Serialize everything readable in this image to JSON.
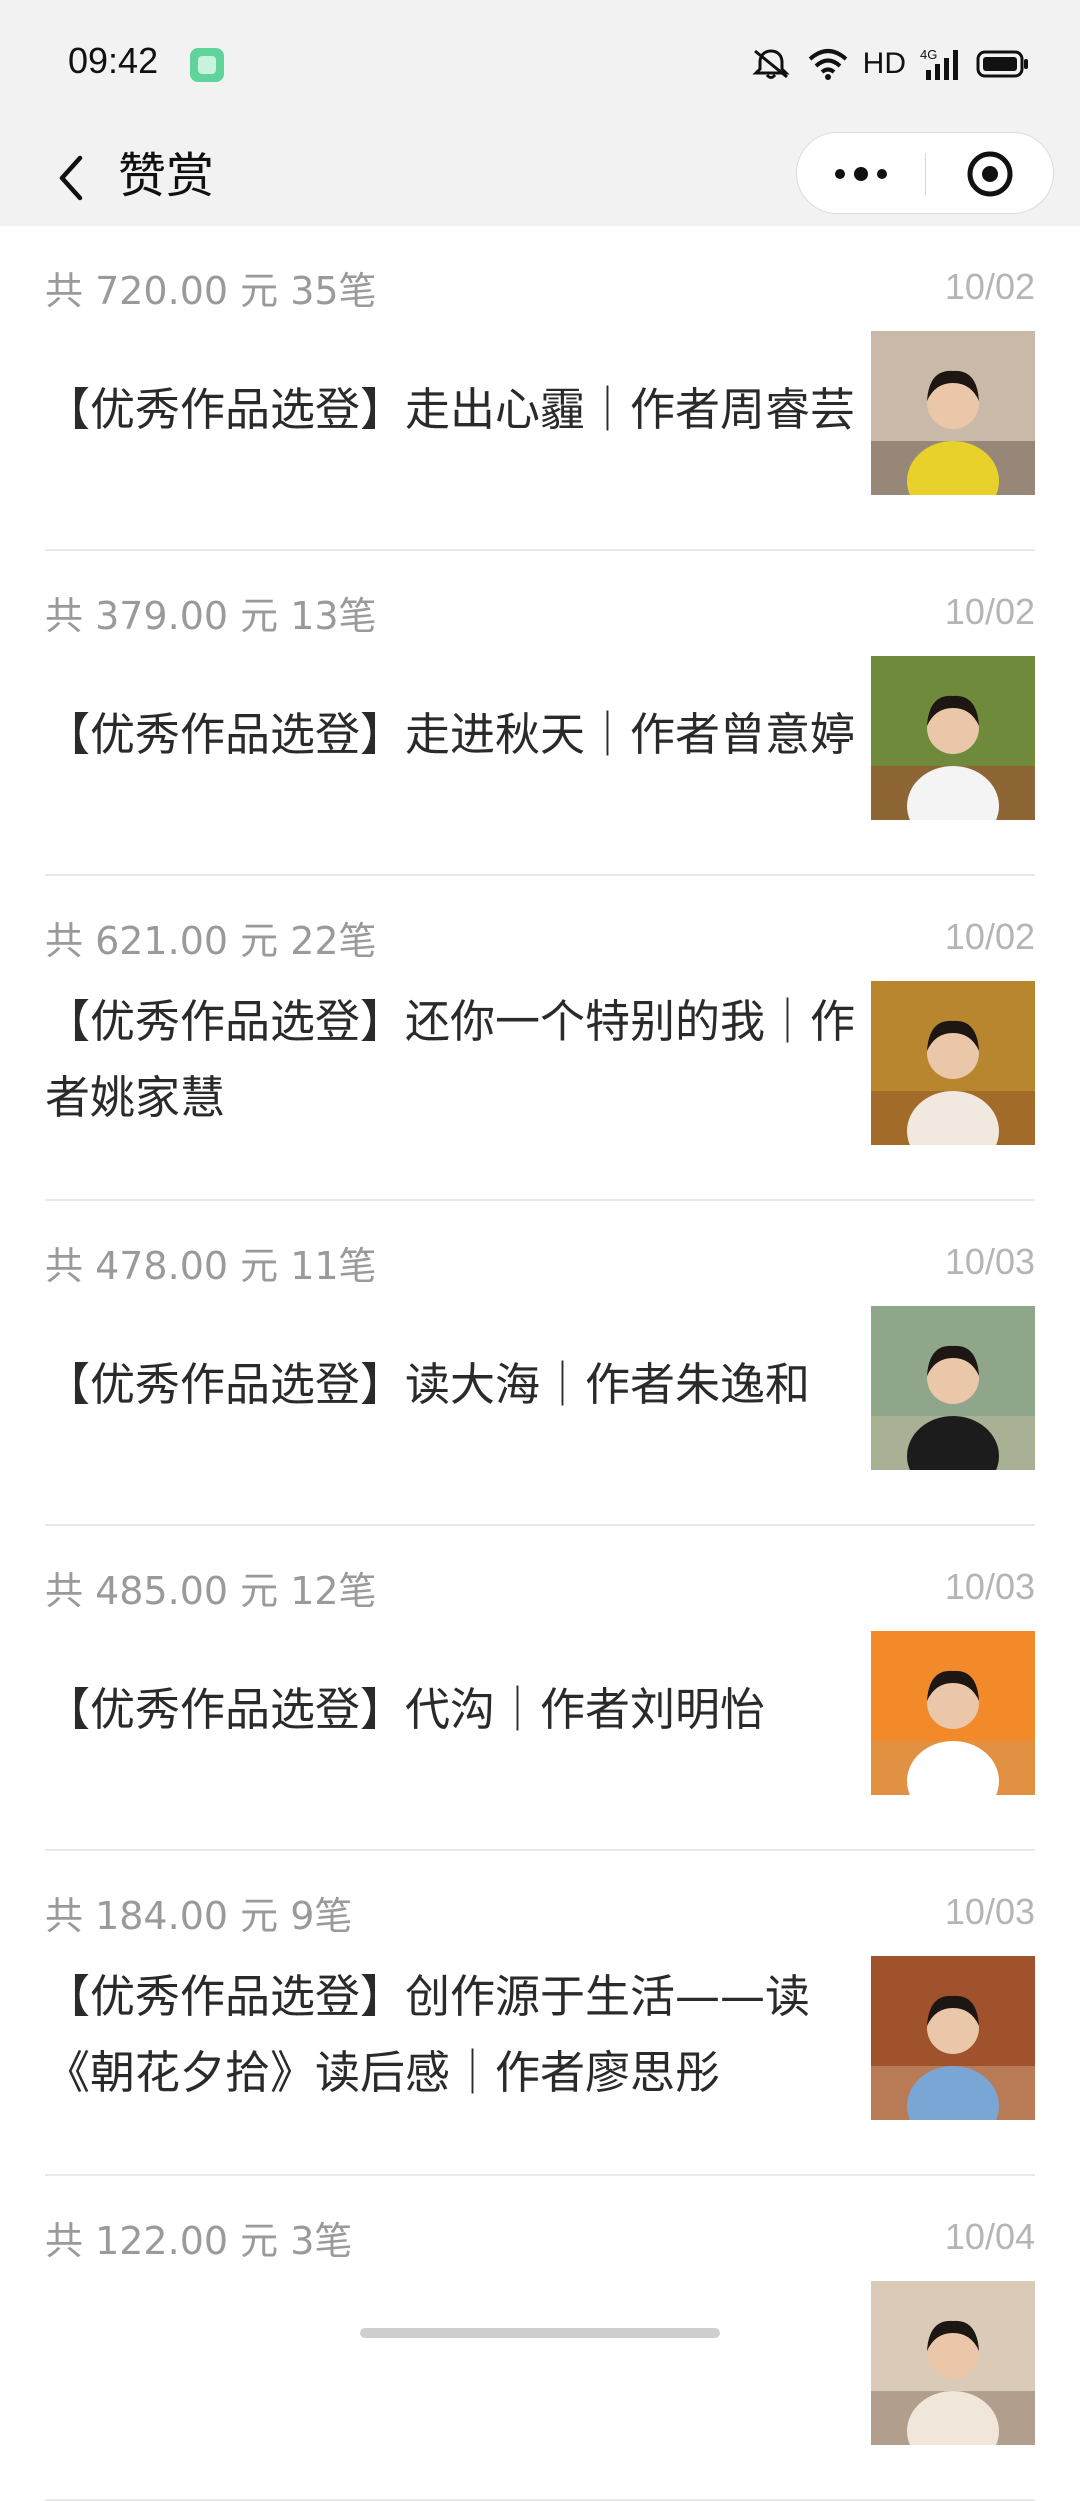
{
  "status": {
    "time": "09:42",
    "hd": "HD",
    "network": "4G"
  },
  "nav": {
    "title": "赞赏"
  },
  "icons": {
    "back": "chevron-left-icon",
    "more": "more-dots-icon",
    "close": "target-close-icon",
    "mute": "mute-icon",
    "wifi": "wifi-icon",
    "signal": "signal-icon",
    "battery": "battery-icon"
  },
  "items": [
    {
      "meta": "共 720.00 元  35笔",
      "date": "10/02",
      "title": "【优秀作品选登】走出心霾｜作者周睿芸",
      "thumb_colors": [
        "#c9b9a8",
        "#e8d12a",
        "#3a2a20"
      ]
    },
    {
      "meta": "共 379.00 元  13笔",
      "date": "10/02",
      "title": "【优秀作品选登】走进秋天｜作者曾意婷",
      "thumb_colors": [
        "#6f8a3a",
        "#f4f4f4",
        "#c8202a"
      ]
    },
    {
      "meta": "共 621.00 元  22笔",
      "date": "10/02",
      "title": "【优秀作品选登】还你一个特别的我｜作者姚家慧",
      "thumb_colors": [
        "#b8862e",
        "#f1e9df",
        "#7a3a20"
      ]
    },
    {
      "meta": "共 478.00 元  11笔",
      "date": "10/03",
      "title": "【优秀作品选登】读大海｜作者朱逸和",
      "thumb_colors": [
        "#8fa68a",
        "#1c1c1c",
        "#d9c7a6"
      ]
    },
    {
      "meta": "共 485.00 元  12笔",
      "date": "10/03",
      "title": "【优秀作品选登】代沟｜作者刘明怡",
      "thumb_colors": [
        "#f28a2a",
        "#ffffff",
        "#c79b6e"
      ]
    },
    {
      "meta": "共 184.00 元  9笔",
      "date": "10/03",
      "title": "【优秀作品选登】创作源于生活——读《朝花夕拾》读后感｜作者廖思彤",
      "thumb_colors": [
        "#a0522d",
        "#7aa6d6",
        "#e7c9a0"
      ]
    },
    {
      "meta": "共 122.00 元  3笔",
      "date": "10/04",
      "title": "",
      "thumb_colors": [
        "#d9cbb8",
        "#f0e6da",
        "#6a4a3a"
      ]
    }
  ]
}
